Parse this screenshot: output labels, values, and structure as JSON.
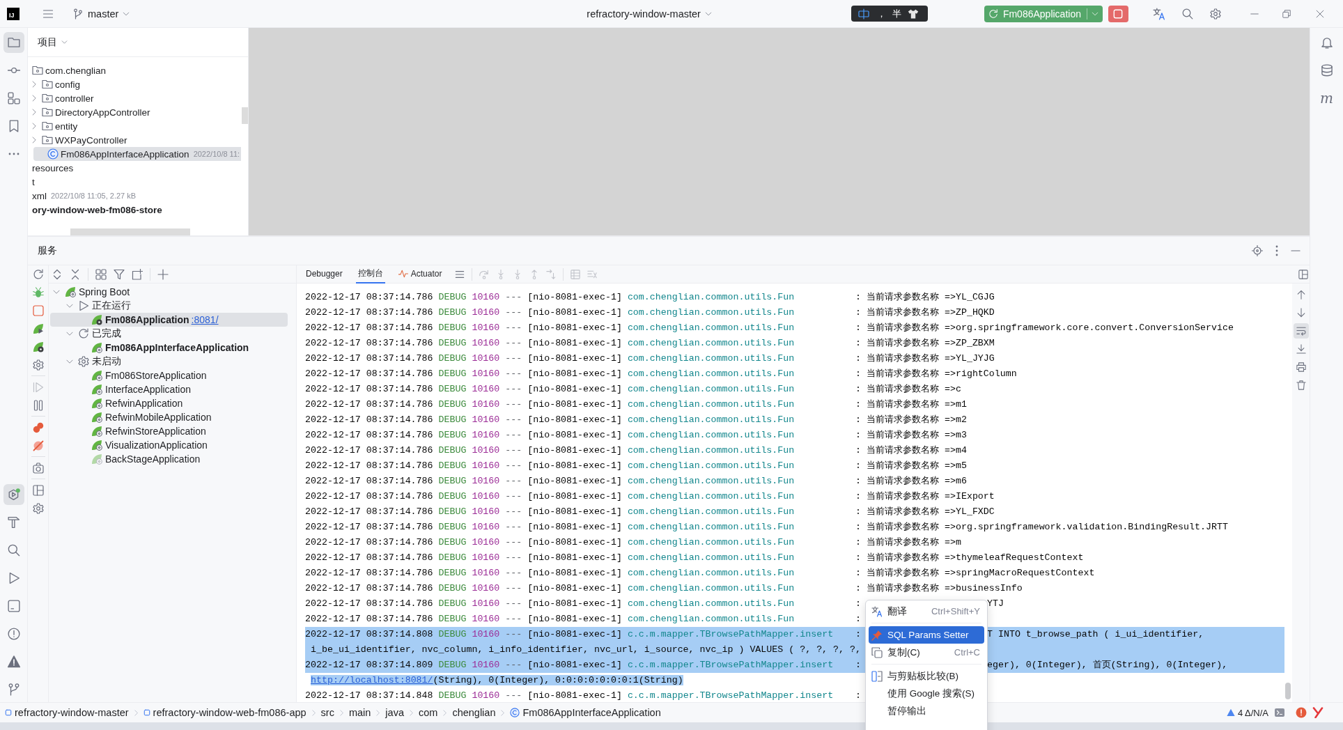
{
  "title_bar": {
    "logo": "IJ",
    "branch": "master",
    "project": "refractory-window-master",
    "ime": {
      "punctuation": "，",
      "width_mode": "半"
    },
    "run_config": "Fm086Application"
  },
  "tool_strip": {
    "top": [
      {
        "kind": "project",
        "selected": true
      },
      {
        "kind": "commit",
        "selected": false
      },
      {
        "kind": "structure",
        "selected": false
      },
      {
        "kind": "bookmarks",
        "selected": false
      },
      {
        "kind": "more",
        "selected": false
      }
    ],
    "bottom": [
      {
        "kind": "services",
        "selected": true
      },
      {
        "kind": "build",
        "selected": false
      },
      {
        "kind": "find",
        "selected": false
      },
      {
        "kind": "run",
        "selected": false
      },
      {
        "kind": "terminal",
        "selected": false
      },
      {
        "kind": "problems",
        "selected": false
      },
      {
        "kind": "warnings",
        "selected": false
      },
      {
        "kind": "git",
        "selected": false
      }
    ]
  },
  "right_strip": [
    {
      "kind": "notifications"
    },
    {
      "kind": "database"
    },
    {
      "kind": "letter",
      "text": "m"
    }
  ],
  "project": {
    "title": "项目",
    "tree": [
      {
        "label": "com.chenglian",
        "kind": "package",
        "expanded": true,
        "selected": false,
        "children": [
          {
            "label": "config",
            "kind": "package",
            "expanded": false,
            "selected": false
          },
          {
            "label": "controller",
            "kind": "package",
            "expanded": false,
            "selected": false
          },
          {
            "label": "DirectoryAppController",
            "kind": "package",
            "expanded": false,
            "selected": false
          },
          {
            "label": "entity",
            "kind": "package",
            "expanded": false,
            "selected": false
          },
          {
            "label": "WXPayController",
            "kind": "package",
            "expanded": false,
            "selected": false
          },
          {
            "label": "Fm086AppInterfaceApplication",
            "kind": "class",
            "meta": "2022/10/8 11:",
            "selected": true
          }
        ]
      },
      {
        "label": "resources",
        "kind": "text",
        "selected": false
      },
      {
        "label": "t",
        "kind": "text",
        "selected": false
      },
      {
        "label": "xml",
        "kind": "text",
        "meta": "2022/10/8 11:05, 2.27 kB",
        "selected": false
      },
      {
        "label": "ory-window-web-fm086-store",
        "kind": "module",
        "selected": false
      }
    ]
  },
  "services": {
    "title": "服务",
    "tools": [
      {
        "kind": "refresh",
        "disabled": false
      },
      {
        "kind": "debug",
        "disabled": false
      },
      {
        "kind": "stop",
        "disabled": false
      },
      {
        "kind": "run-app",
        "disabled": false
      },
      {
        "kind": "debug-app",
        "disabled": false
      },
      {
        "kind": "settings",
        "disabled": false
      },
      {
        "kind": "separator"
      },
      {
        "kind": "resume",
        "disabled": true
      },
      {
        "kind": "pause",
        "disabled": false
      },
      {
        "kind": "separator"
      },
      {
        "kind": "breakpoints",
        "disabled": false
      },
      {
        "kind": "mute",
        "disabled": false
      },
      {
        "kind": "separator"
      },
      {
        "kind": "camera",
        "disabled": false
      },
      {
        "kind": "separator"
      },
      {
        "kind": "layout",
        "disabled": false
      },
      {
        "kind": "settings",
        "disabled": false
      }
    ],
    "tree": [
      {
        "label": "Spring Boot",
        "kind": "group",
        "expanded": true,
        "selected": false,
        "children": [
          {
            "label": "正在运行",
            "kind": "running",
            "expanded": true,
            "selected": false,
            "children": [
              {
                "label": "Fm086Application",
                "port": ":8081/",
                "kind": "debugging",
                "active": true,
                "selected": true
              }
            ]
          },
          {
            "label": "已完成",
            "kind": "finished",
            "expanded": true,
            "selected": false,
            "children": [
              {
                "label": "Fm086AppInterfaceApplication",
                "kind": "app",
                "active": true,
                "selected": false
              }
            ]
          },
          {
            "label": "未启动",
            "kind": "idle",
            "expanded": true,
            "selected": false,
            "children": [
              {
                "label": "Fm086StoreApplication",
                "kind": "app",
                "active": false,
                "selected": false
              },
              {
                "label": "InterfaceApplication",
                "kind": "app",
                "active": false,
                "selected": false
              },
              {
                "label": "RefwinApplication",
                "kind": "app",
                "active": false,
                "selected": false
              },
              {
                "label": "RefwinMobileApplication",
                "kind": "app",
                "active": false,
                "selected": false
              },
              {
                "label": "RefwinStoreApplication",
                "kind": "app",
                "active": false,
                "selected": false
              },
              {
                "label": "VisualizationApplication",
                "kind": "app",
                "active": false,
                "selected": false
              },
              {
                "label": "BackStageApplication",
                "kind": "faded-app",
                "active": false,
                "selected": false
              }
            ]
          }
        ]
      }
    ]
  },
  "console": {
    "tabs": [
      {
        "label": "Debugger",
        "kind": "plain",
        "selected": false
      },
      {
        "label": "控制台",
        "kind": "plain",
        "selected": true
      },
      {
        "label": "Actuator",
        "kind": "actuator",
        "selected": false
      }
    ],
    "toolbar": [
      {
        "kind": "tabs-menu",
        "disabled": false
      },
      {
        "kind": "separator"
      },
      {
        "kind": "step-over",
        "disabled": true
      },
      {
        "kind": "step-into",
        "disabled": true
      },
      {
        "kind": "step-into",
        "disabled": true
      },
      {
        "kind": "step-out",
        "disabled": true
      },
      {
        "kind": "run-to-cursor",
        "disabled": true
      },
      {
        "kind": "separator"
      },
      {
        "kind": "frames",
        "disabled": true
      },
      {
        "kind": "evaluate",
        "disabled": true
      }
    ],
    "side_tools": [
      {
        "kind": "up",
        "on": false
      },
      {
        "kind": "down",
        "on": false
      },
      {
        "kind": "wrap",
        "on": true
      },
      {
        "kind": "scroll-end",
        "on": false
      },
      {
        "kind": "print",
        "on": false
      },
      {
        "kind": "clear",
        "on": false
      }
    ],
    "lines": [
      {
        "kind": "log",
        "time": "2022-12-17 08:37:14.786",
        "level": "DEBUG",
        "pid": "10160",
        "sep": "---",
        "thread": "[nio-8081-exec-1]",
        "logger": "com.chenglian.common.utils.Fun",
        "colon": ":",
        "message": "当前请求参数名称 =>YL_CGJG",
        "selected": false
      },
      {
        "kind": "log",
        "time": "2022-12-17 08:37:14.786",
        "level": "DEBUG",
        "pid": "10160",
        "sep": "---",
        "thread": "[nio-8081-exec-1]",
        "logger": "com.chenglian.common.utils.Fun",
        "colon": ":",
        "message": "当前请求参数名称 =>ZP_HQKD",
        "selected": false
      },
      {
        "kind": "log",
        "time": "2022-12-17 08:37:14.786",
        "level": "DEBUG",
        "pid": "10160",
        "sep": "---",
        "thread": "[nio-8081-exec-1]",
        "logger": "com.chenglian.common.utils.Fun",
        "colon": ":",
        "message": "当前请求参数名称 =>org.springframework.core.convert.ConversionService",
        "selected": false
      },
      {
        "kind": "log",
        "time": "2022-12-17 08:37:14.786",
        "level": "DEBUG",
        "pid": "10160",
        "sep": "---",
        "thread": "[nio-8081-exec-1]",
        "logger": "com.chenglian.common.utils.Fun",
        "colon": ":",
        "message": "当前请求参数名称 =>ZP_ZBXM",
        "selected": false
      },
      {
        "kind": "log",
        "time": "2022-12-17 08:37:14.786",
        "level": "DEBUG",
        "pid": "10160",
        "sep": "---",
        "thread": "[nio-8081-exec-1]",
        "logger": "com.chenglian.common.utils.Fun",
        "colon": ":",
        "message": "当前请求参数名称 =>YL_JYJG",
        "selected": false
      },
      {
        "kind": "log",
        "time": "2022-12-17 08:37:14.786",
        "level": "DEBUG",
        "pid": "10160",
        "sep": "---",
        "thread": "[nio-8081-exec-1]",
        "logger": "com.chenglian.common.utils.Fun",
        "colon": ":",
        "message": "当前请求参数名称 =>rightColumn",
        "selected": false
      },
      {
        "kind": "log",
        "time": "2022-12-17 08:37:14.786",
        "level": "DEBUG",
        "pid": "10160",
        "sep": "---",
        "thread": "[nio-8081-exec-1]",
        "logger": "com.chenglian.common.utils.Fun",
        "colon": ":",
        "message": "当前请求参数名称 =>c",
        "selected": false
      },
      {
        "kind": "log",
        "time": "2022-12-17 08:37:14.786",
        "level": "DEBUG",
        "pid": "10160",
        "sep": "---",
        "thread": "[nio-8081-exec-1]",
        "logger": "com.chenglian.common.utils.Fun",
        "colon": ":",
        "message": "当前请求参数名称 =>m1",
        "selected": false
      },
      {
        "kind": "log",
        "time": "2022-12-17 08:37:14.786",
        "level": "DEBUG",
        "pid": "10160",
        "sep": "---",
        "thread": "[nio-8081-exec-1]",
        "logger": "com.chenglian.common.utils.Fun",
        "colon": ":",
        "message": "当前请求参数名称 =>m2",
        "selected": false
      },
      {
        "kind": "log",
        "time": "2022-12-17 08:37:14.786",
        "level": "DEBUG",
        "pid": "10160",
        "sep": "---",
        "thread": "[nio-8081-exec-1]",
        "logger": "com.chenglian.common.utils.Fun",
        "colon": ":",
        "message": "当前请求参数名称 =>m3",
        "selected": false
      },
      {
        "kind": "log",
        "time": "2022-12-17 08:37:14.786",
        "level": "DEBUG",
        "pid": "10160",
        "sep": "---",
        "thread": "[nio-8081-exec-1]",
        "logger": "com.chenglian.common.utils.Fun",
        "colon": ":",
        "message": "当前请求参数名称 =>m4",
        "selected": false
      },
      {
        "kind": "log",
        "time": "2022-12-17 08:37:14.786",
        "level": "DEBUG",
        "pid": "10160",
        "sep": "---",
        "thread": "[nio-8081-exec-1]",
        "logger": "com.chenglian.common.utils.Fun",
        "colon": ":",
        "message": "当前请求参数名称 =>m5",
        "selected": false
      },
      {
        "kind": "log",
        "time": "2022-12-17 08:37:14.786",
        "level": "DEBUG",
        "pid": "10160",
        "sep": "---",
        "thread": "[nio-8081-exec-1]",
        "logger": "com.chenglian.common.utils.Fun",
        "colon": ":",
        "message": "当前请求参数名称 =>m6",
        "selected": false
      },
      {
        "kind": "log",
        "time": "2022-12-17 08:37:14.786",
        "level": "DEBUG",
        "pid": "10160",
        "sep": "---",
        "thread": "[nio-8081-exec-1]",
        "logger": "com.chenglian.common.utils.Fun",
        "colon": ":",
        "message": "当前请求参数名称 =>IExport",
        "selected": false
      },
      {
        "kind": "log",
        "time": "2022-12-17 08:37:14.786",
        "level": "DEBUG",
        "pid": "10160",
        "sep": "---",
        "thread": "[nio-8081-exec-1]",
        "logger": "com.chenglian.common.utils.Fun",
        "colon": ":",
        "message": "当前请求参数名称 =>YL_FXDC",
        "selected": false
      },
      {
        "kind": "log",
        "time": "2022-12-17 08:37:14.786",
        "level": "DEBUG",
        "pid": "10160",
        "sep": "---",
        "thread": "[nio-8081-exec-1]",
        "logger": "com.chenglian.common.utils.Fun",
        "colon": ":",
        "message": "当前请求参数名称 =>org.springframework.validation.BindingResult.JRTT",
        "selected": false
      },
      {
        "kind": "log",
        "time": "2022-12-17 08:37:14.786",
        "level": "DEBUG",
        "pid": "10160",
        "sep": "---",
        "thread": "[nio-8081-exec-1]",
        "logger": "com.chenglian.common.utils.Fun",
        "colon": ":",
        "message": "当前请求参数名称 =>m",
        "selected": false
      },
      {
        "kind": "log",
        "time": "2022-12-17 08:37:14.786",
        "level": "DEBUG",
        "pid": "10160",
        "sep": "---",
        "thread": "[nio-8081-exec-1]",
        "logger": "com.chenglian.common.utils.Fun",
        "colon": ":",
        "message": "当前请求参数名称 =>thymeleafRequestContext",
        "selected": false
      },
      {
        "kind": "log",
        "time": "2022-12-17 08:37:14.786",
        "level": "DEBUG",
        "pid": "10160",
        "sep": "---",
        "thread": "[nio-8081-exec-1]",
        "logger": "com.chenglian.common.utils.Fun",
        "colon": ":",
        "message": "当前请求参数名称 =>springMacroRequestContext",
        "selected": false
      },
      {
        "kind": "log",
        "time": "2022-12-17 08:37:14.786",
        "level": "DEBUG",
        "pid": "10160",
        "sep": "---",
        "thread": "[nio-8081-exec-1]",
        "logger": "com.chenglian.common.utils.Fun",
        "colon": ":",
        "message": "当前请求参数名称 =>businessInfo",
        "selected": false
      },
      {
        "kind": "log",
        "time": "2022-12-17 08:37:14.786",
        "level": "DEBUG",
        "pid": "10160",
        "sep": "---",
        "thread": "[nio-8081-exec-1]",
        "logger": "com.chenglian.common.utils.Fun",
        "colon": ":",
        "tail": "YTJ",
        "selected": false
      },
      {
        "kind": "log",
        "time": "2022-12-17 08:37:14.786",
        "level": "DEBUG",
        "pid": "10160",
        "sep": "---",
        "thread": "[nio-8081-exec-1]",
        "logger": "com.chenglian.common.utils.Fun",
        "colon": ":",
        "selected": false
      },
      {
        "kind": "log",
        "time": "2022-12-17 08:37:14.808",
        "level": "DEBUG",
        "pid": "10160",
        "sep": "---",
        "thread": "[nio-8081-exec-1]",
        "logger": "c.c.m.mapper.TBrowsePathMapper.insert",
        "colon": ":",
        "tail": "T INTO t_browse_path ( i_ui_identifier,",
        "selected": true
      },
      {
        "kind": "wrap",
        "text": "i_be_ui_identifier, nvc_column, i_info_identifier, nvc_url, i_source, nvc_ip ) VALUES ( ?, ?, ?, ?,",
        "selected": true
      },
      {
        "kind": "log",
        "time": "2022-12-17 08:37:14.809",
        "level": "DEBUG",
        "pid": "10160",
        "sep": "---",
        "thread": "[nio-8081-exec-1]",
        "logger": "c.c.m.mapper.TBrowsePathMapper.insert",
        "colon": ":",
        "tail": "eger), 0(Integer), 首页(String), 0(Integer),",
        "selected": true
      },
      {
        "kind": "wrap",
        "link": "http://localhost:8081/",
        "text": "(String), 0(Integer), 0:0:0:0:0:0:0:1(String)",
        "selected": true
      },
      {
        "kind": "log",
        "time": "2022-12-17 08:37:14.848",
        "level": "DEBUG",
        "pid": "10160",
        "sep": "---",
        "thread": "[nio-8081-exec-1]",
        "logger": "c.c.m.mapper.TBrowsePathMapper.insert",
        "colon": ":",
        "selected": false
      }
    ]
  },
  "context_menu": [
    {
      "kind": "translate",
      "label": "翻译",
      "shortcut": "Ctrl+Shift+Y",
      "selected": false
    },
    {
      "kind": "separator"
    },
    {
      "kind": "plugin",
      "label": "SQL Params Setter",
      "selected": true
    },
    {
      "kind": "copy",
      "label": "复制(C)",
      "shortcut": "Ctrl+C",
      "selected": false
    },
    {
      "kind": "separator"
    },
    {
      "kind": "compare",
      "label": "与剪贴板比较(B)",
      "selected": false
    },
    {
      "kind": "plain",
      "label": "使用 Google 搜索(S)",
      "selected": false
    },
    {
      "kind": "plain",
      "label": "暂停输出",
      "selected": false
    }
  ],
  "status_bar": {
    "breadcrumbs": [
      {
        "label": "refractory-window-master",
        "kind": "module"
      },
      {
        "label": "refractory-window-web-fm086-app",
        "kind": "module"
      },
      {
        "label": "src",
        "kind": "folder"
      },
      {
        "label": "main",
        "kind": "folder"
      },
      {
        "label": "java",
        "kind": "folder"
      },
      {
        "label": "com",
        "kind": "folder"
      },
      {
        "label": "chenglian",
        "kind": "folder"
      },
      {
        "label": "Fm086AppInterfaceApplication",
        "kind": "class"
      }
    ],
    "inspection": "4 Δ/N/A"
  }
}
